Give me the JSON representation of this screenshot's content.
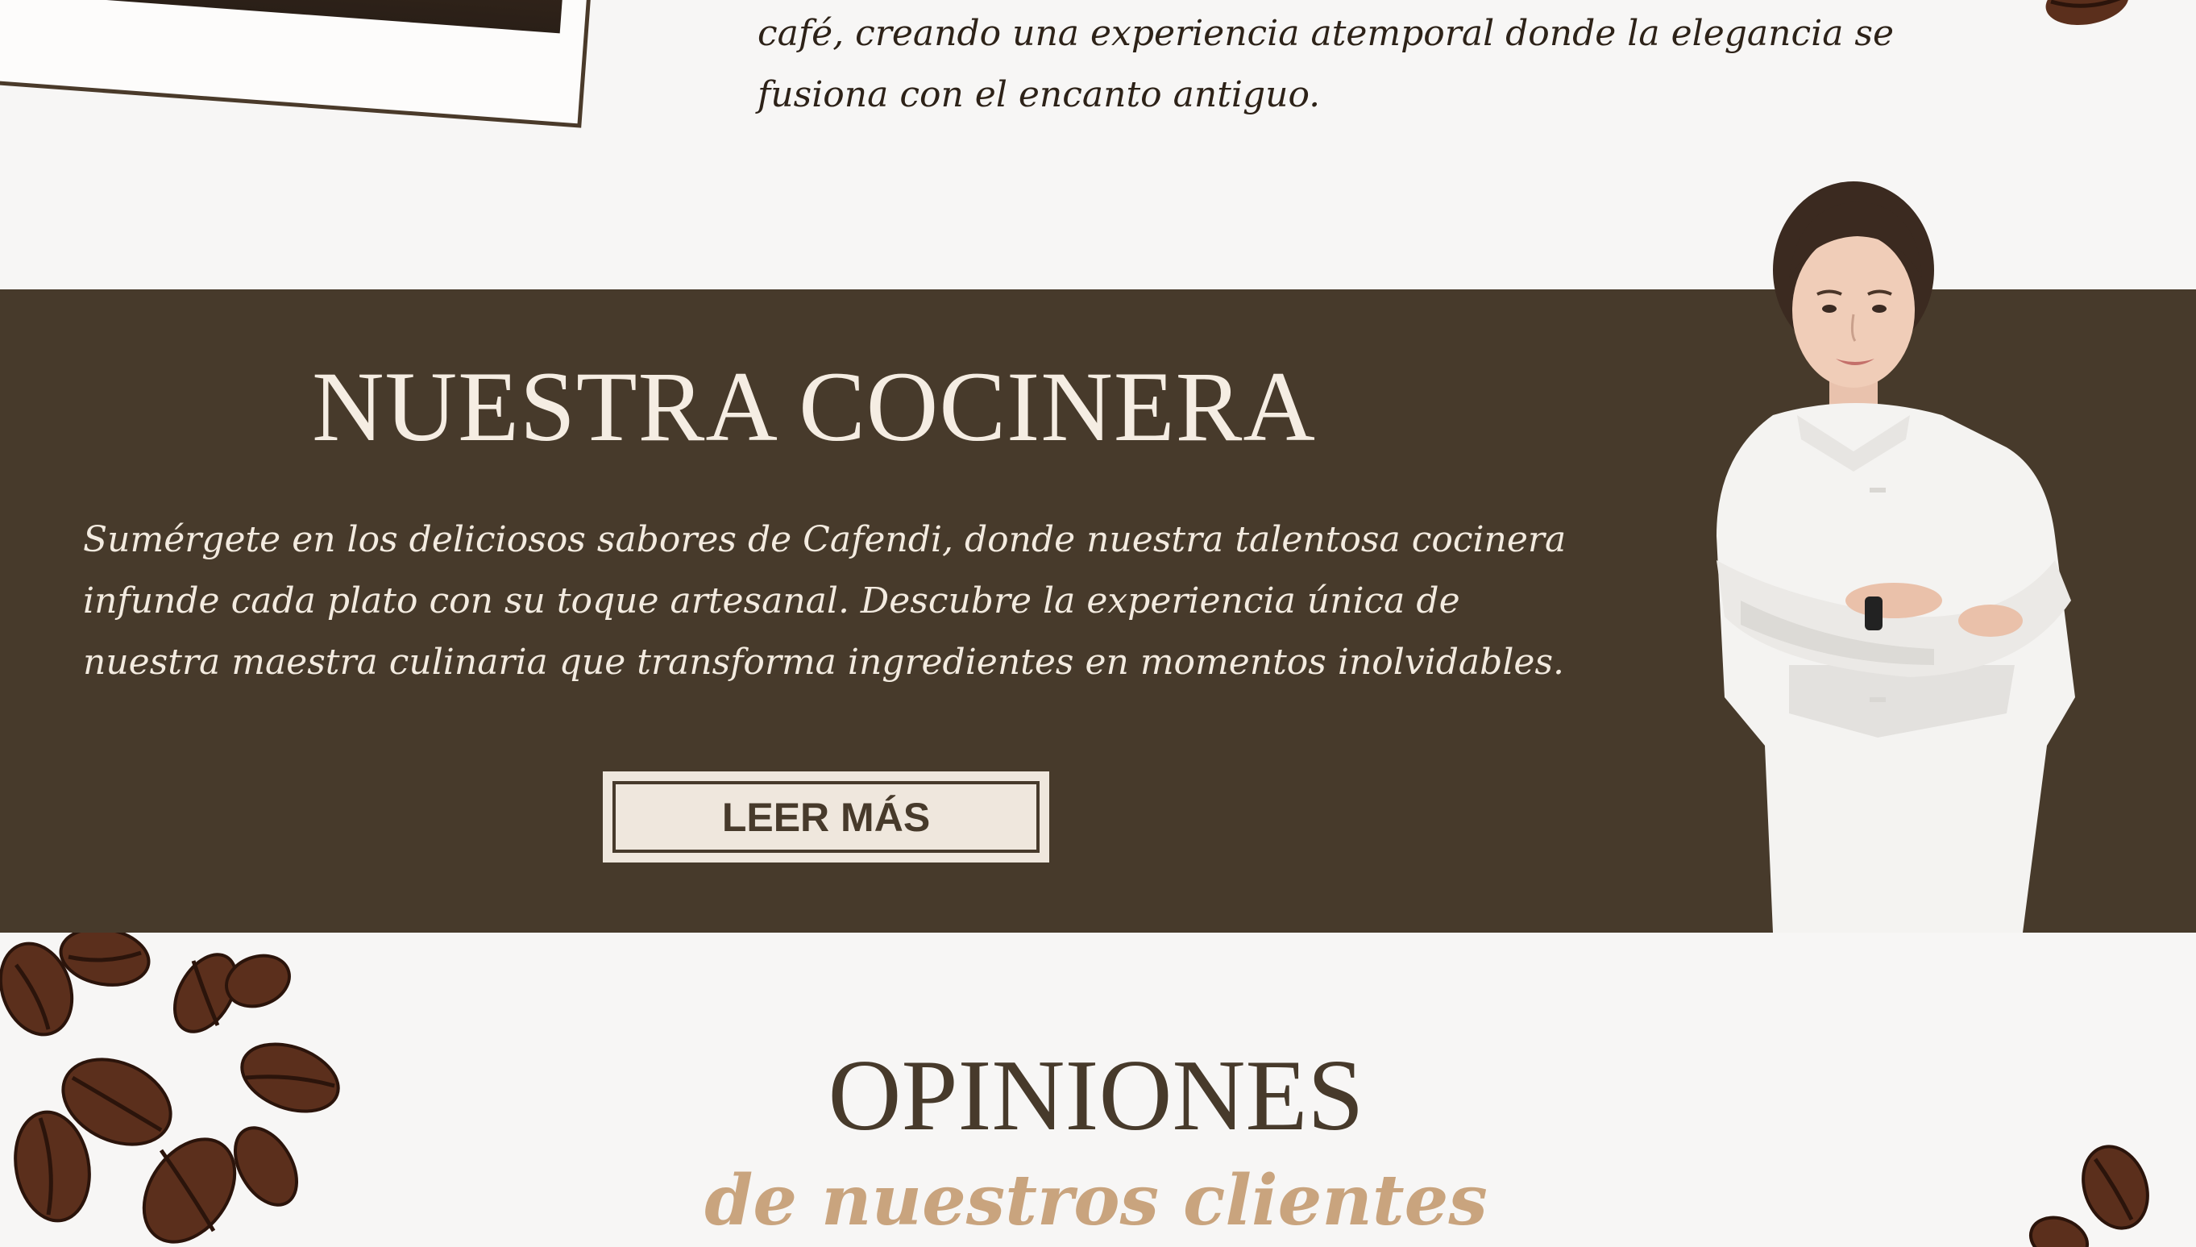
{
  "intro": {
    "line1": "café, creando una experiencia atemporal donde la elegancia se",
    "line2": "fusiona con el encanto antiguo."
  },
  "chef_section": {
    "title": "NUESTRA COCINERA",
    "text_line1": "Sumérgete en los deliciosos sabores de Cafendi, donde nuestra talentosa cocinera",
    "text_line2": "infunde cada plato con su toque artesanal. Descubre la experiencia única de",
    "text_line3": "nuestra maestra culinaria que transforma ingredientes en momentos inolvidables.",
    "button_label": "LEER MÁS",
    "image": "chef-portrait"
  },
  "opinions": {
    "title": "OPINIONES",
    "subtitle": "de nuestros clientes"
  },
  "colors": {
    "band": "#473a2b",
    "background": "#f7f6f5",
    "button_bg": "#efe7dd",
    "accent": "#c9a47e"
  }
}
